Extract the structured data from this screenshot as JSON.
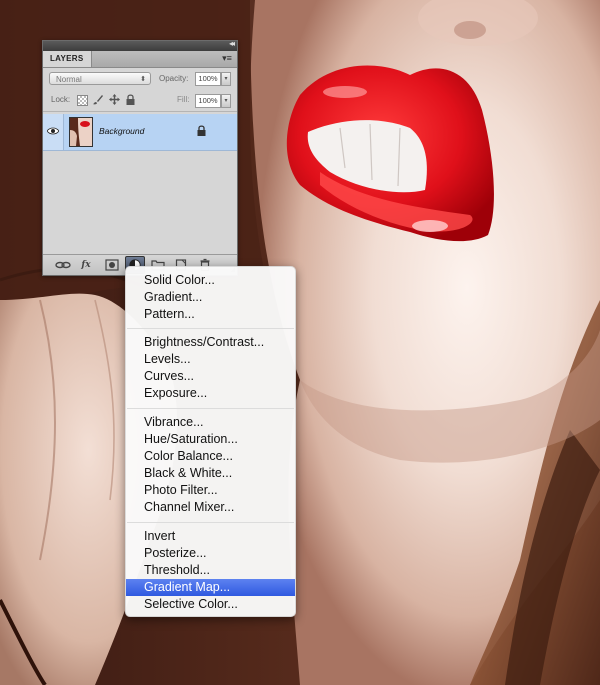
{
  "panel": {
    "tab_label": "LAYERS",
    "panel_menu_glyph": "▾≡",
    "collapse_glyph": "◂◂",
    "blend_mode": "Normal",
    "opacity_label": "Opacity:",
    "opacity_value": "100%",
    "lock_label": "Lock:",
    "fill_label": "Fill:",
    "fill_value": "100%",
    "stepper_glyph": "▾",
    "layers": [
      {
        "name": "Background",
        "visible": true,
        "locked": true,
        "selected": true
      }
    ],
    "bottom_icons": [
      "link-icon",
      "fx-icon",
      "mask-icon",
      "adjustment-icon",
      "folder-icon",
      "new-layer-icon",
      "trash-icon"
    ],
    "fx_label": "fx"
  },
  "menu": {
    "groups": [
      [
        "Solid Color...",
        "Gradient...",
        "Pattern..."
      ],
      [
        "Brightness/Contrast...",
        "Levels...",
        "Curves...",
        "Exposure..."
      ],
      [
        "Vibrance...",
        "Hue/Saturation...",
        "Color Balance...",
        "Black & White...",
        "Photo Filter...",
        "Channel Mixer..."
      ],
      [
        "Invert",
        "Posterize...",
        "Threshold...",
        "Gradient Map...",
        "Selective Color..."
      ]
    ],
    "highlighted": "Gradient Map...",
    "highlight_color": "#3d66e6"
  },
  "colors": {
    "selection_blue": "#b7d3f3",
    "panel_gray": "#d6d6d6",
    "lip_red": "#e0101a"
  }
}
